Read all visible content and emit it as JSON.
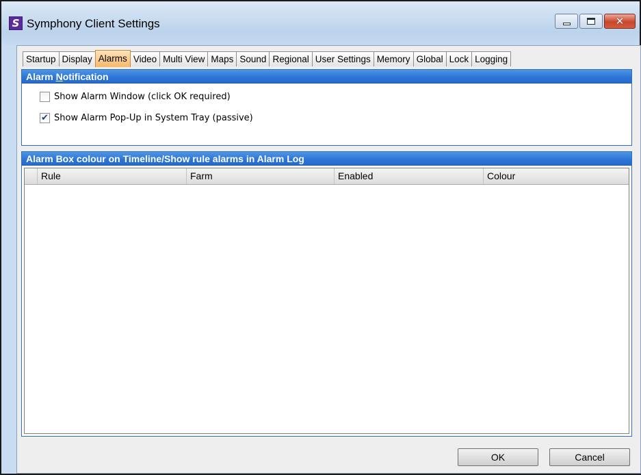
{
  "window": {
    "title": "Symphony Client Settings",
    "app_icon_letter": "S",
    "icon_color": "#5b2b9c"
  },
  "tabs": [
    {
      "label": "Startup"
    },
    {
      "label": "Display"
    },
    {
      "label": "Alarms",
      "active": true
    },
    {
      "label": "Video"
    },
    {
      "label": "Multi View"
    },
    {
      "label": "Maps"
    },
    {
      "label": "Sound"
    },
    {
      "label": "Regional"
    },
    {
      "label": "User Settings"
    },
    {
      "label": "Memory"
    },
    {
      "label": "Global"
    },
    {
      "label": "Lock"
    },
    {
      "label": "Logging"
    }
  ],
  "alarm_notification": {
    "header_pre": "Alarm ",
    "header_mnemonic": "N",
    "header_post": "otification",
    "show_alarm_window": {
      "label": "Show Alarm Window (click OK required)",
      "checked": false
    },
    "show_alarm_popup": {
      "label": "Show Alarm Pop-Up in System Tray (passive)",
      "checked": true
    }
  },
  "alarm_box": {
    "header": "Alarm Box colour on Timeline/Show rule alarms in Alarm Log",
    "columns": [
      "Rule",
      "Farm",
      "Enabled",
      "Colour"
    ],
    "rows": []
  },
  "footer": {
    "ok_label": "OK",
    "cancel_label": "Cancel"
  },
  "colors": {
    "panel_header": "#2b74d6",
    "active_tab": "#f7b86b"
  }
}
